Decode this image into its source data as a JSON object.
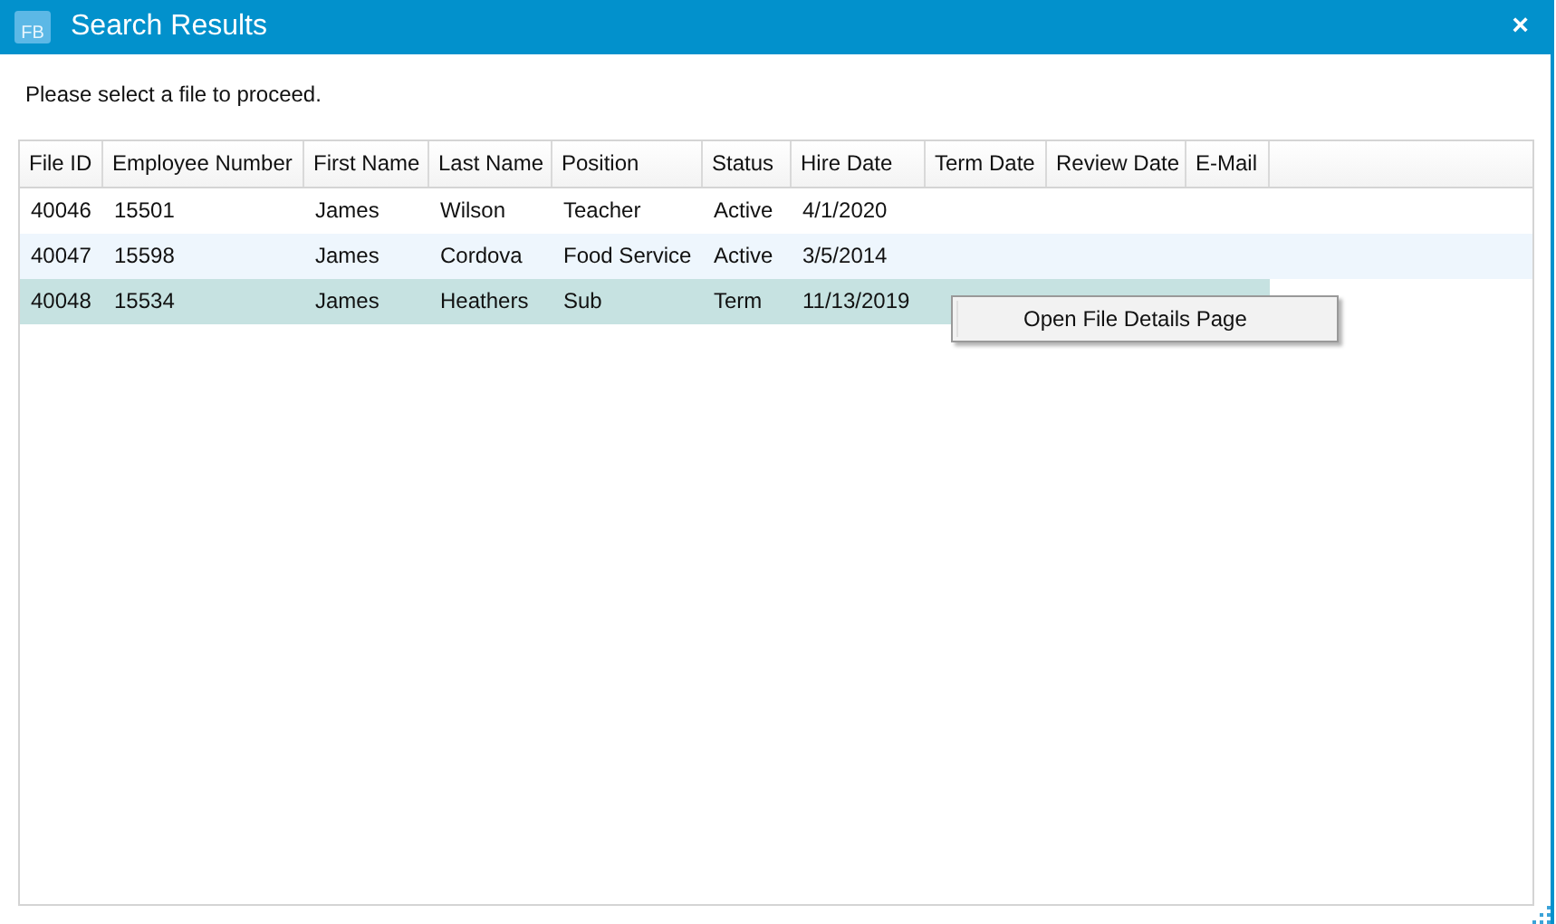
{
  "window": {
    "title": "Search Results",
    "icon_text": "FB",
    "close": "×"
  },
  "prompt": "Please select a file to proceed.",
  "table": {
    "columns": [
      "File ID",
      "Employee Number",
      "First Name",
      "Last Name",
      "Position",
      "Status",
      "Hire Date",
      "Term Date",
      "Review Date",
      "E-Mail"
    ],
    "rows": [
      {
        "cells": [
          "40046",
          "15501",
          "James",
          "Wilson",
          "Teacher",
          "Active",
          "4/1/2020",
          "",
          "",
          ""
        ],
        "selected": false
      },
      {
        "cells": [
          "40047",
          "15598",
          "James",
          "Cordova",
          "Food Service",
          "Active",
          "3/5/2014",
          "",
          "",
          ""
        ],
        "selected": false
      },
      {
        "cells": [
          "40048",
          "15534",
          "James",
          "Heathers",
          "Sub",
          "Term",
          "11/13/2019",
          "",
          "",
          ""
        ],
        "selected": true
      }
    ]
  },
  "context_menu": {
    "items": [
      "Open File Details Page"
    ]
  }
}
